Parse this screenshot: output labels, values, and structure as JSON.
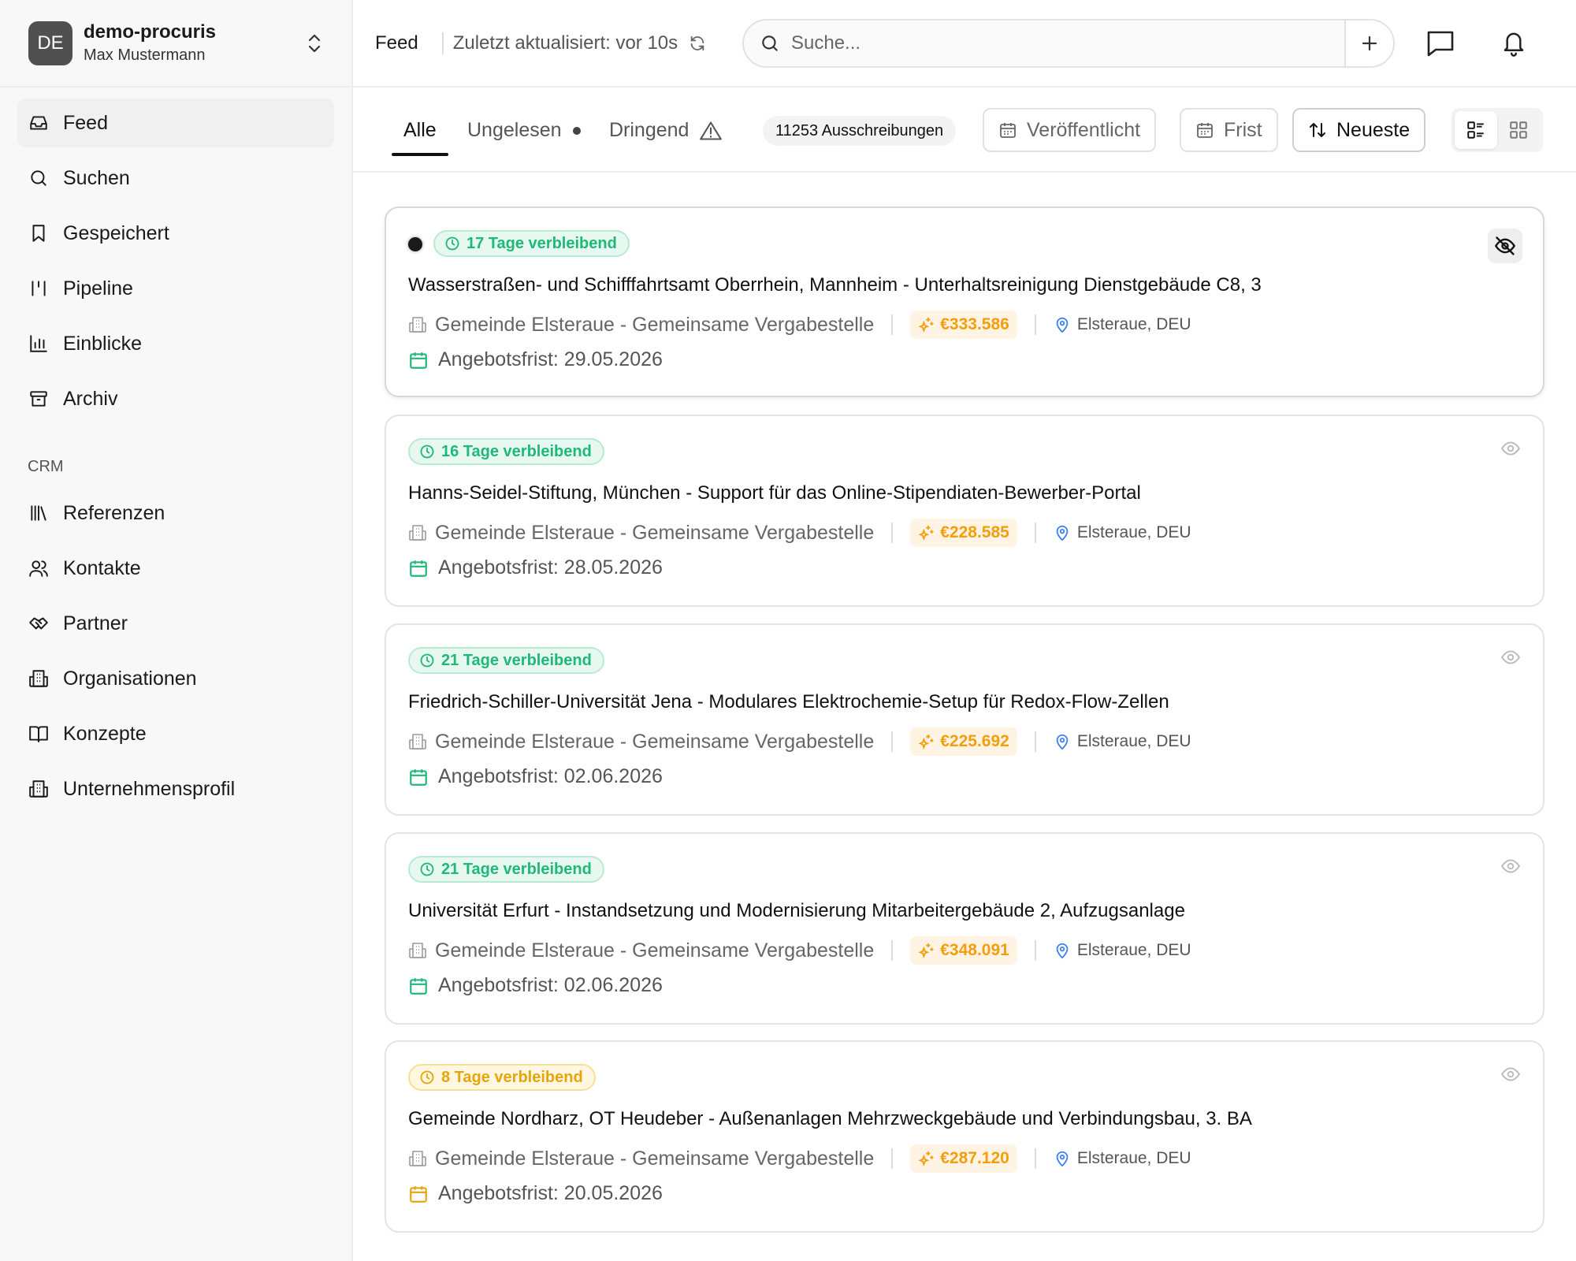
{
  "workspace": {
    "avatar": "DE",
    "name": "demo-procuris",
    "user": "Max Mustermann"
  },
  "nav": {
    "items": [
      {
        "label": "Feed",
        "icon": "inbox-icon"
      },
      {
        "label": "Suchen",
        "icon": "search-icon"
      },
      {
        "label": "Gespeichert",
        "icon": "bookmark-icon"
      },
      {
        "label": "Pipeline",
        "icon": "pipeline-icon"
      },
      {
        "label": "Einblicke",
        "icon": "bar-chart-icon"
      },
      {
        "label": "Archiv",
        "icon": "archive-icon"
      }
    ],
    "crm_label": "CRM",
    "crm_items": [
      {
        "label": "Referenzen",
        "icon": "library-icon"
      },
      {
        "label": "Kontakte",
        "icon": "users-icon"
      },
      {
        "label": "Partner",
        "icon": "handshake-icon"
      },
      {
        "label": "Organisationen",
        "icon": "building-icon"
      },
      {
        "label": "Konzepte",
        "icon": "book-open-icon"
      },
      {
        "label": "Unternehmensprofil",
        "icon": "building-icon"
      }
    ]
  },
  "topbar": {
    "title": "Feed",
    "updated": "Zuletzt aktualisiert: vor 10s",
    "search_placeholder": "Suche..."
  },
  "filters": {
    "tabs": [
      "Alle",
      "Ungelesen",
      "Dringend"
    ],
    "active_tab": "Alle",
    "count": "11253 Ausschreibungen",
    "published": "Veröffentlicht",
    "deadline": "Frist",
    "sort": "Neueste",
    "view": "list"
  },
  "colors": {
    "green": "#1fb878",
    "amber": "#e6a40d",
    "value": "#f59e0b",
    "location": "#3b82f6"
  },
  "cards": [
    {
      "unread": true,
      "remaining": "17 Tage verbleibend",
      "urgency": "green",
      "title": "Wasserstraßen- und Schifffahrtsamt Oberrhein, Mannheim - Unterhaltsreinigung Dienstgebäude C8, 3",
      "org": "Gemeinde Elsteraue - Gemeinsame Vergabestelle",
      "value": "€333.586",
      "location": "Elsteraue, DEU",
      "deadline": "Angebotsfrist: 29.05.2026",
      "hidden_icon": "eye-off-icon"
    },
    {
      "unread": false,
      "remaining": "16 Tage verbleibend",
      "urgency": "green",
      "title": "Hanns-Seidel-Stiftung, München - Support für das Online-Stipendiaten-Bewerber-Portal",
      "org": "Gemeinde Elsteraue - Gemeinsame Vergabestelle",
      "value": "€228.585",
      "location": "Elsteraue, DEU",
      "deadline": "Angebotsfrist: 28.05.2026",
      "hidden_icon": "eye-icon"
    },
    {
      "unread": false,
      "remaining": "21 Tage verbleibend",
      "urgency": "green",
      "title": "Friedrich-Schiller-Universität Jena - Modulares Elektrochemie-Setup für Redox-Flow-Zellen",
      "org": "Gemeinde Elsteraue - Gemeinsame Vergabestelle",
      "value": "€225.692",
      "location": "Elsteraue, DEU",
      "deadline": "Angebotsfrist: 02.06.2026",
      "hidden_icon": "eye-icon"
    },
    {
      "unread": false,
      "remaining": "21 Tage verbleibend",
      "urgency": "green",
      "title": "Universität Erfurt - Instandsetzung und Modernisierung Mitarbeitergebäude 2, Aufzugsanlage",
      "org": "Gemeinde Elsteraue - Gemeinsame Vergabestelle",
      "value": "€348.091",
      "location": "Elsteraue, DEU",
      "deadline": "Angebotsfrist: 02.06.2026",
      "hidden_icon": "eye-icon"
    },
    {
      "unread": false,
      "remaining": "8 Tage verbleibend",
      "urgency": "amber",
      "title": "Gemeinde Nordharz, OT Heudeber - Außenanlagen Mehrzweckgebäude und Verbindungsbau, 3. BA",
      "org": "Gemeinde Elsteraue - Gemeinsame Vergabestelle",
      "value": "€287.120",
      "location": "Elsteraue, DEU",
      "deadline": "Angebotsfrist: 20.05.2026",
      "hidden_icon": "eye-icon"
    }
  ]
}
